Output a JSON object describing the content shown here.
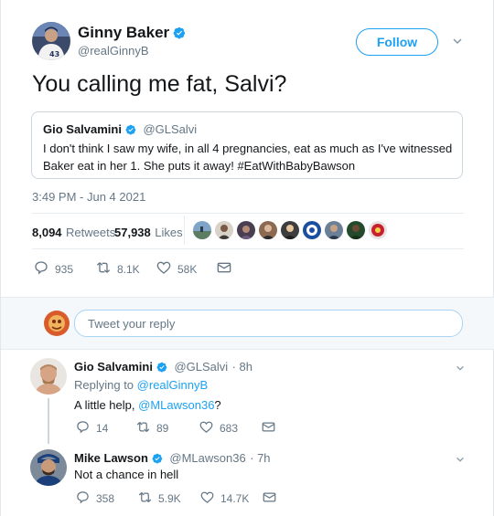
{
  "tweet": {
    "author_name": "Ginny Baker",
    "author_handle": "@realGinnyB",
    "follow_label": "Follow",
    "text": "You calling me fat, Salvi?",
    "quoted": {
      "name": "Gio Salvamini",
      "handle": "@GLSalvi",
      "text": "I don't think I saw my wife, in all 4 pregnancies, eat as much as I've witnessed Baker eat in her 1. She puts it away! #EatWithBabyBawson"
    },
    "timestamp": "3:49 PM - Jun 4 2021",
    "stats": {
      "retweets_count": "8,094",
      "retweets_label": "Retweets",
      "likes_count": "57,938",
      "likes_label": "Likes"
    },
    "actions": {
      "replies": "935",
      "retweets": "8.1K",
      "likes": "58K"
    }
  },
  "reply_box": {
    "placeholder": "Tweet your reply"
  },
  "replies": [
    {
      "name": "Gio Salvamini",
      "handle": "@GLSalvi",
      "time": "· 8h",
      "replying_prefix": "Replying to",
      "replying_to": "@realGinnyB",
      "text_prefix": "A little help,",
      "mention": "@MLawson36",
      "text_suffix": "?",
      "replies": "14",
      "retweets": "89",
      "likes": "683"
    },
    {
      "name": "Mike Lawson",
      "handle": "@MLawson36",
      "time": "· 7h",
      "text": "Not a chance in hell",
      "replies": "358",
      "retweets": "5.9K",
      "likes": "14.7K"
    }
  ],
  "colors": {
    "accent": "#1da1f2",
    "text": "#14171a",
    "muted": "#657786"
  }
}
